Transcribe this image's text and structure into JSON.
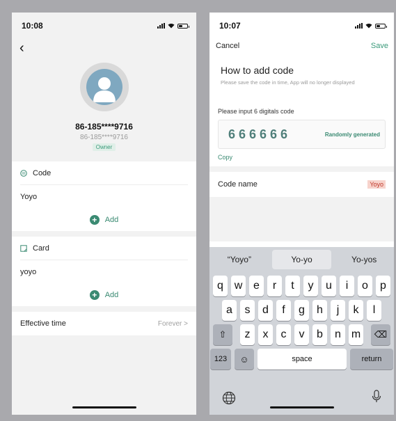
{
  "left": {
    "status": {
      "time": "10:08"
    },
    "profile": {
      "phone": "86-185****9716",
      "sub": "86-185****9716",
      "role": "Owner"
    },
    "code_section": {
      "title": "Code",
      "value": "Yoyo",
      "add": "Add"
    },
    "card_section": {
      "title": "Card",
      "value": "yoyo",
      "add": "Add"
    },
    "effective": {
      "label": "Effective time",
      "value": "Forever >"
    }
  },
  "right": {
    "status": {
      "time": "10:07"
    },
    "nav": {
      "cancel": "Cancel",
      "save": "Save"
    },
    "title": "How to add code",
    "note": "Please save the code in time, App will no longer displayed",
    "input_label": "Please input 6 digitals code",
    "code": "666666",
    "randomize": "Randomly generated",
    "copy": "Copy",
    "name": {
      "label": "Code name",
      "value": "Yoyo"
    },
    "keyboard": {
      "suggestions": [
        "“Yoyo”",
        "Yo-yo",
        "Yo-yos"
      ],
      "row1": [
        "q",
        "w",
        "e",
        "r",
        "t",
        "y",
        "u",
        "i",
        "o",
        "p"
      ],
      "row2": [
        "a",
        "s",
        "d",
        "f",
        "g",
        "h",
        "j",
        "k",
        "l"
      ],
      "row3": [
        "z",
        "x",
        "c",
        "v",
        "b",
        "n",
        "m"
      ],
      "shift": "⇧",
      "backspace": "⌫",
      "num": "123",
      "emoji": "☺",
      "space": "space",
      "return": "return"
    }
  },
  "colors": {
    "accent": "#3a8a72",
    "highlight": "#f7d3cc"
  }
}
